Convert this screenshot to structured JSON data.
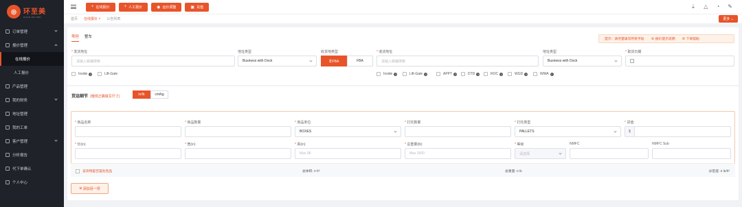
{
  "sidebar": {
    "logo_title": "环至美",
    "logo_sub": "HUAN ZHI MEI",
    "items": [
      {
        "label": "订单管理"
      },
      {
        "label": "报价管理"
      },
      {
        "label": "在线报价"
      },
      {
        "label": "人工报价"
      },
      {
        "label": "产品管理"
      },
      {
        "label": "我的财务"
      },
      {
        "label": "地址管理"
      },
      {
        "label": "我的工单"
      },
      {
        "label": "客户管理"
      },
      {
        "label": "分析报告"
      },
      {
        "label": "代下单确认"
      },
      {
        "label": "个人中心"
      }
    ]
  },
  "topbar": {
    "buttons": [
      {
        "label": "在线报价"
      },
      {
        "label": "人工报价"
      },
      {
        "label": "运价调整"
      },
      {
        "label": "充值"
      }
    ]
  },
  "tabs": [
    {
      "label": "首页"
    },
    {
      "label": "在线报价 ×"
    },
    {
      "label": "公告列表"
    }
  ],
  "more_label": "更多",
  "card1": {
    "subtabs": [
      "零担",
      "整车"
    ],
    "hint": {
      "text": "提示：请尽量填写所有字段",
      "link1": "报价提示说明",
      "link2": "下单帮助"
    },
    "labels": {
      "from_addr": "发货地址",
      "from_type": "地址类型",
      "recv_type": "收货地类型",
      "to_addr": "收货地址",
      "to_type": "地址类型",
      "pickup_date": "取货日期"
    },
    "from_addr_placeholder": "请输入邮编搜索",
    "from_type_value": "Business with Dock",
    "recv_seg": [
      "非FBA",
      "FBA"
    ],
    "to_addr_placeholder": "请输入邮编搜索",
    "to_type_value": "Business with Dock",
    "left_checks": [
      "Inside",
      "Lift-Gate"
    ],
    "right_checks": [
      "Inside",
      "Lift-Gate",
      "APPT",
      "DTD",
      "ROC",
      "WGD",
      "WWA"
    ]
  },
  "card2": {
    "title": "货运细节",
    "note": "(箱规正确填写尺寸)",
    "units": [
      "in/lb",
      "cm/kg"
    ],
    "row1_labels": [
      "商品名称",
      "商品数量",
      "商品单位",
      "打托数量",
      "打托类型",
      "货值"
    ],
    "unit_value": "BOXES",
    "pallet_value": "PALLETS",
    "currency": "$",
    "row2_labels": [
      "长(in)",
      "宽(in)",
      "高(in)",
      "总重量(lb)",
      "等级",
      "NMFC",
      "NMFC Sub"
    ],
    "max_h": "Max 98",
    "max_w": "Max 3000",
    "class_placeholder": "请选择",
    "dangerous": "该货物是否是危险品",
    "total_volume": "总体积: 0 ft³",
    "total_weight": "总重量: 0 lb",
    "density": "@密度: 0 lb/ft³",
    "add_label": "添加另一项"
  },
  "colors": {
    "accent": "#e8542a",
    "sidebar": "#1f2229"
  }
}
